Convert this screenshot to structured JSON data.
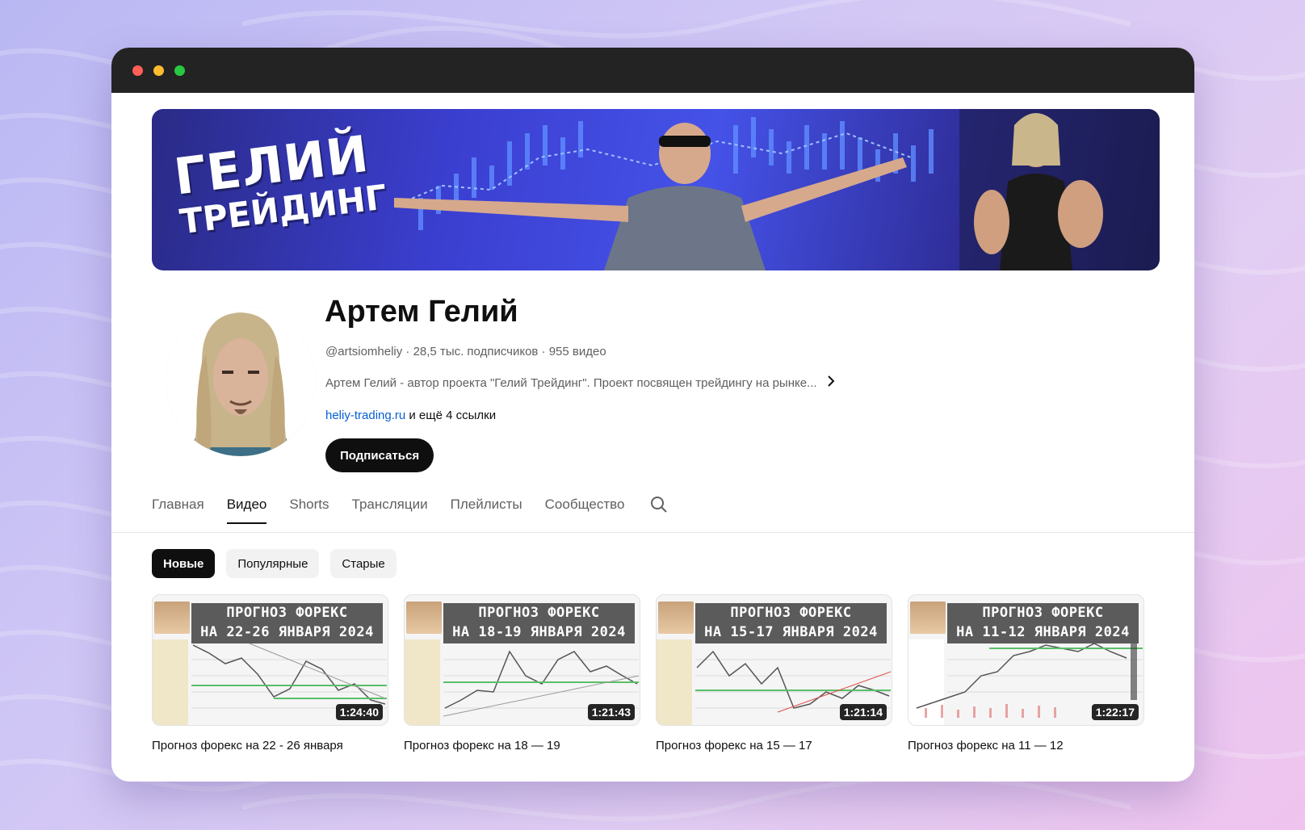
{
  "banner": {
    "line1": "ГЕЛИЙ",
    "line2": "ТРЕЙДИНГ"
  },
  "channel": {
    "name": "Артем Гелий",
    "meta": "@artsiomheliy · 28,5 тыс. подписчиков · 955 видео",
    "description": "Артем Гелий - автор проекта \"Гелий Трейдинг\". Проект посвящен трейдингу на рынке...",
    "link": "heliy-trading.ru",
    "link_more": "и ещё 4 ссылки",
    "subscribe_label": "Подписаться"
  },
  "tabs": [
    {
      "label": "Главная"
    },
    {
      "label": "Видео"
    },
    {
      "label": "Shorts"
    },
    {
      "label": "Трансляции"
    },
    {
      "label": "Плейлисты"
    },
    {
      "label": "Сообщество"
    }
  ],
  "chips": [
    {
      "label": "Новые"
    },
    {
      "label": "Популярные"
    },
    {
      "label": "Старые"
    }
  ],
  "videos": [
    {
      "thumb_line1": "ПРОГНОЗ ФОРЕКС",
      "thumb_line2": "НА 22-26 ЯНВАРЯ 2024",
      "duration": "1:24:40",
      "title": "Прогноз форекс на 22 - 26 января"
    },
    {
      "thumb_line1": "ПРОГНОЗ ФОРЕКС",
      "thumb_line2": "НА 18-19 ЯНВАРЯ 2024",
      "duration": "1:21:43",
      "title": "Прогноз форекс на 18 — 19"
    },
    {
      "thumb_line1": "ПРОГНОЗ ФОРЕКС",
      "thumb_line2": "НА 15-17 ЯНВАРЯ 2024",
      "duration": "1:21:14",
      "title": "Прогноз форекс на 15 — 17"
    },
    {
      "thumb_line1": "ПРОГНОЗ ФОРЕКС",
      "thumb_line2": "НА 11-12 ЯНВАРЯ 2024",
      "duration": "1:22:17",
      "title": "Прогноз форекс на 11 — 12"
    }
  ],
  "icons": {
    "search": "search-icon",
    "chevron": "chevron-right-icon"
  }
}
